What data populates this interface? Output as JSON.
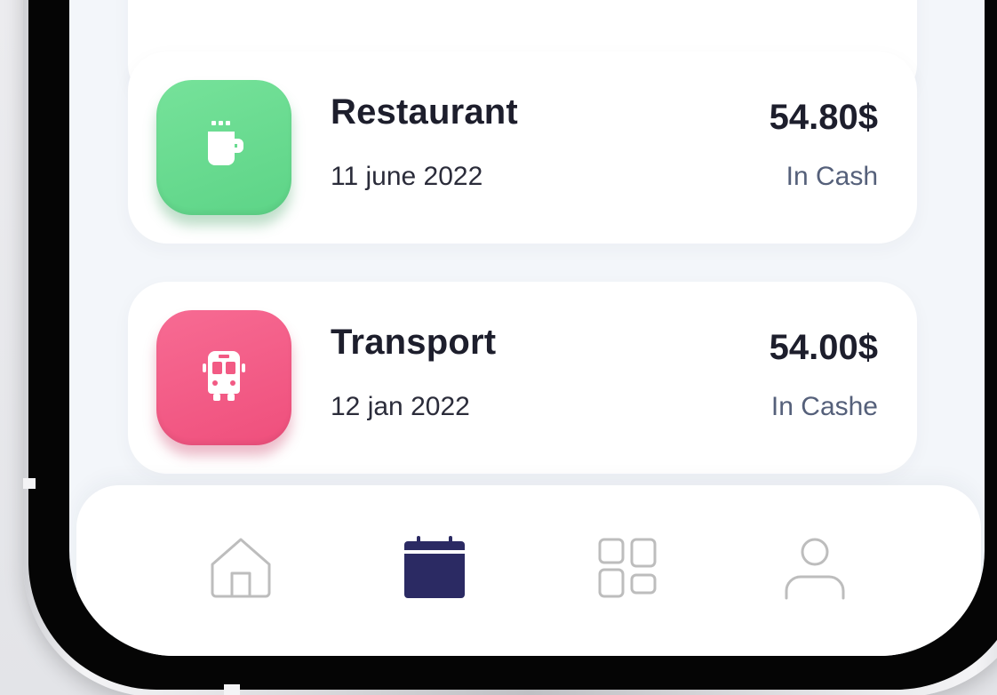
{
  "transactions": [
    {
      "category": "Restaurant",
      "date": "11 june 2022",
      "amount": "54.80$",
      "method": "In Cash",
      "icon": "coffee-cup-icon",
      "color": "#66d98f"
    },
    {
      "category": "Transport",
      "date": "12 jan 2022",
      "amount": "54.00$",
      "method": "In Cashe",
      "icon": "bus-icon",
      "color": "#f25a84"
    }
  ],
  "nav": {
    "items": [
      {
        "icon": "home-icon",
        "active": false
      },
      {
        "icon": "calendar-icon",
        "active": true
      },
      {
        "icon": "grid-icon",
        "active": false
      },
      {
        "icon": "profile-icon",
        "active": false
      }
    ],
    "active_color": "#2b2a63",
    "inactive_color": "#bdbdbd"
  }
}
